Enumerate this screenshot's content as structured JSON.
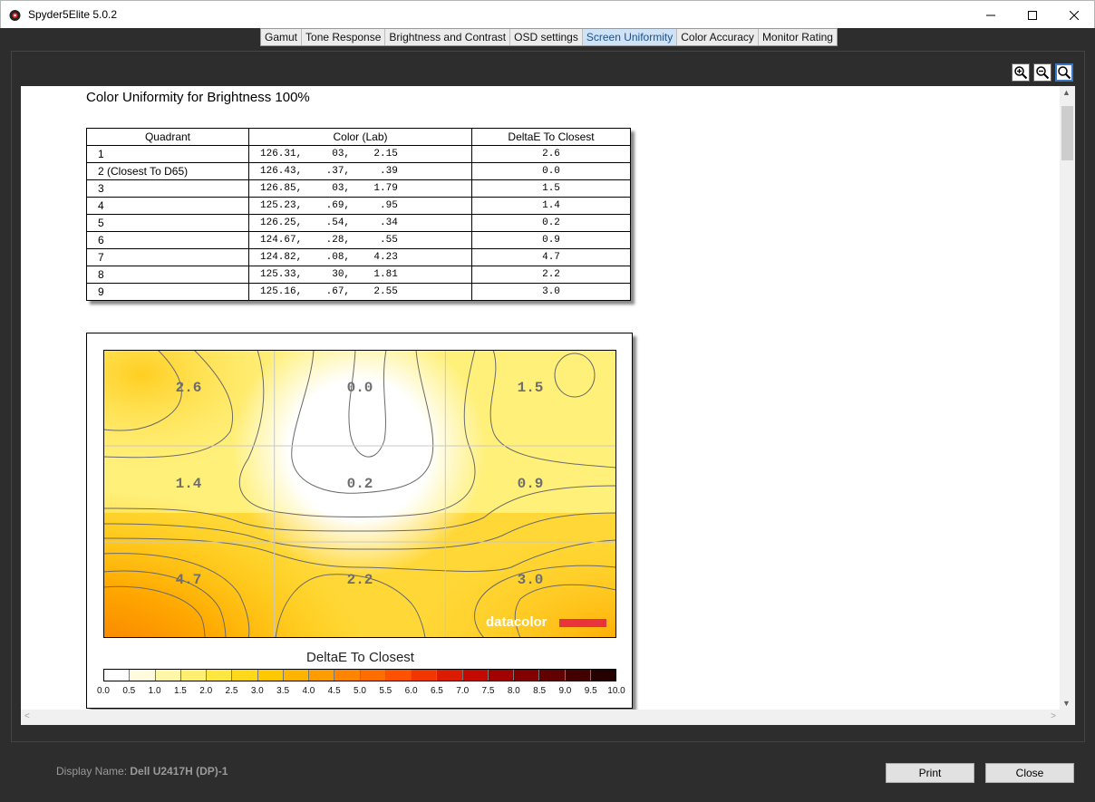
{
  "window": {
    "title": "Spyder5Elite 5.0.2"
  },
  "tabs": [
    {
      "label": "Gamut",
      "active": false
    },
    {
      "label": "Tone Response",
      "active": false
    },
    {
      "label": "Brightness and Contrast",
      "active": false
    },
    {
      "label": "OSD settings",
      "active": false
    },
    {
      "label": "Screen Uniformity",
      "active": true
    },
    {
      "label": "Color Accuracy",
      "active": false
    },
    {
      "label": "Monitor Rating",
      "active": false
    }
  ],
  "report": {
    "title": "Color Uniformity for Brightness 100%",
    "table": {
      "headers": [
        "Quadrant",
        "Color (Lab)",
        "DeltaE To Closest"
      ],
      "rows": [
        {
          "quadrant": "1",
          "lab": "126.31,     03,    2.15",
          "delta": "2.6"
        },
        {
          "quadrant": "2 (Closest To D65)",
          "lab": "126.43,    .37,     .39",
          "delta": "0.0"
        },
        {
          "quadrant": "3",
          "lab": "126.85,     03,    1.79",
          "delta": "1.5"
        },
        {
          "quadrant": "4",
          "lab": "125.23,    .69,     .95",
          "delta": "1.4"
        },
        {
          "quadrant": "5",
          "lab": "126.25,    .54,     .34",
          "delta": "0.2"
        },
        {
          "quadrant": "6",
          "lab": "124.67,    .28,     .55",
          "delta": "0.9"
        },
        {
          "quadrant": "7",
          "lab": "124.82,    .08,    4.23",
          "delta": "4.7"
        },
        {
          "quadrant": "8",
          "lab": "125.33,     30,    1.81",
          "delta": "2.2"
        },
        {
          "quadrant": "9",
          "lab": "125.16,    .67,    2.55",
          "delta": "3.0"
        }
      ]
    },
    "chart": {
      "grid_labels": [
        "2.6",
        "0.0",
        "1.5",
        "1.4",
        "0.2",
        "0.9",
        "4.7",
        "2.2",
        "3.0"
      ],
      "legend_title": "DeltaE To Closest",
      "scale_ticks": [
        "0.0",
        "0.5",
        "1.0",
        "1.5",
        "2.0",
        "2.5",
        "3.0",
        "3.5",
        "4.0",
        "4.5",
        "5.0",
        "5.5",
        "6.0",
        "6.5",
        "7.0",
        "7.5",
        "8.0",
        "8.5",
        "9.0",
        "9.5",
        "10.0"
      ],
      "scale_colors": [
        "#ffffff",
        "#fffbdc",
        "#fff6a8",
        "#ffef70",
        "#ffe640",
        "#ffd81a",
        "#ffc800",
        "#ffb400",
        "#ff9d00",
        "#ff8500",
        "#ff6d00",
        "#ff5200",
        "#f23600",
        "#db1c00",
        "#c20a00",
        "#a30000",
        "#820000",
        "#610000",
        "#430000",
        "#260000"
      ],
      "brand": "datacolor"
    }
  },
  "footer": {
    "display_label": "Display Name:",
    "display_value": "Dell U2417H (DP)-1",
    "print_label": "Print",
    "close_label": "Close"
  }
}
